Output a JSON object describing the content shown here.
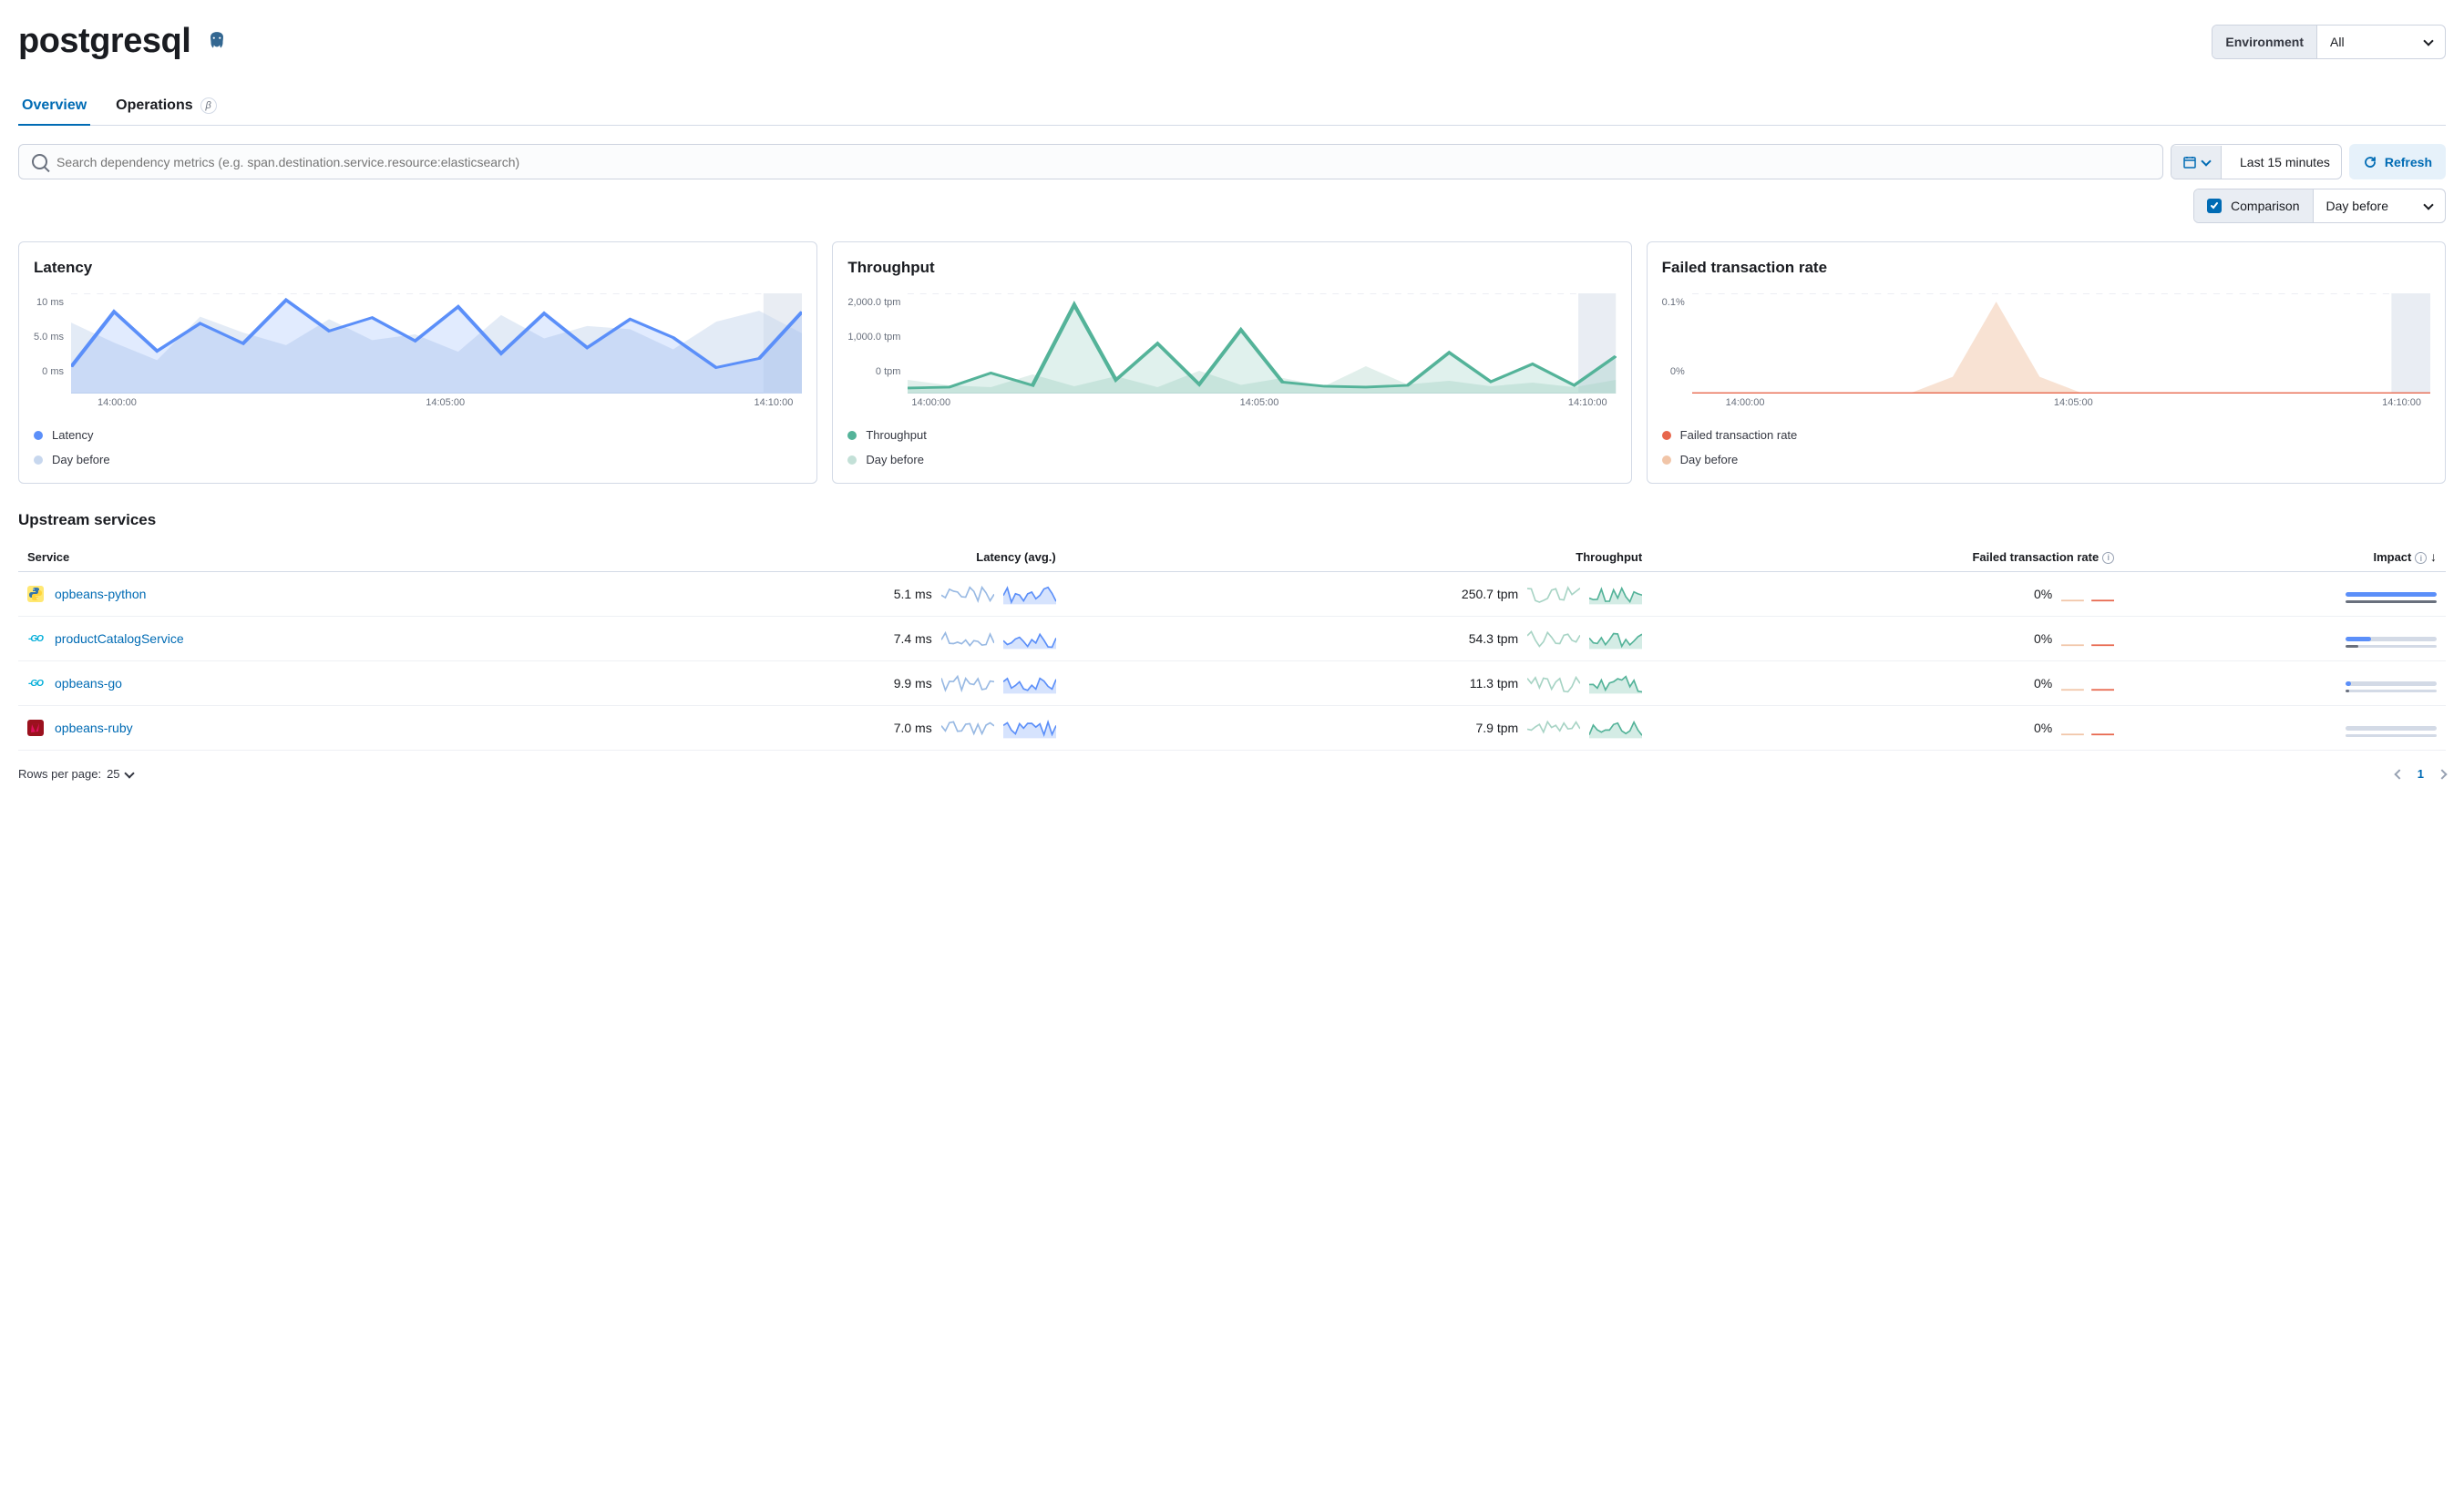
{
  "header": {
    "title": "postgresql",
    "environment_label": "Environment",
    "environment_value": "All"
  },
  "tabs": [
    {
      "label": "Overview",
      "active": true
    },
    {
      "label": "Operations",
      "active": false,
      "beta": true,
      "beta_glyph": "β"
    }
  ],
  "search": {
    "placeholder": "Search dependency metrics (e.g. span.destination.service.resource:elasticsearch)"
  },
  "timerange": {
    "value": "Last 15 minutes"
  },
  "refresh_label": "Refresh",
  "comparison": {
    "label": "Comparison",
    "value": "Day before",
    "checked": true
  },
  "chart_x_ticks": [
    "14:00:00",
    "14:05:00",
    "14:10:00"
  ],
  "chart_data": [
    {
      "type": "area",
      "title": "Latency",
      "y_ticks": [
        "10 ms",
        "5.0 ms",
        "0 ms"
      ],
      "ylim": [
        0,
        12
      ],
      "categories": [
        "14:00:00",
        "14:05:00",
        "14:10:00"
      ],
      "series": [
        {
          "name": "Latency",
          "color": "#5b8ff9",
          "values": [
            3.2,
            9.8,
            5.1,
            8.4,
            6.0,
            11.2,
            7.5,
            9.1,
            6.3,
            10.4,
            4.8,
            9.6,
            5.5,
            8.9,
            6.7,
            3.1,
            4.2,
            9.8
          ]
        },
        {
          "name": "Day before",
          "color": "#c7d7ee",
          "values": [
            8.5,
            6.1,
            4.0,
            9.2,
            7.3,
            5.8,
            8.9,
            6.4,
            7.1,
            5.0,
            9.4,
            6.6,
            8.1,
            7.7,
            5.3,
            8.6,
            9.9,
            7.2
          ]
        }
      ],
      "legend": [
        {
          "label": "Latency",
          "color": "#5b8ff9"
        },
        {
          "label": "Day before",
          "color": "#c7d7ee"
        }
      ]
    },
    {
      "type": "area",
      "title": "Throughput",
      "y_ticks": [
        "2,000.0 tpm",
        "1,000.0 tpm",
        "0 tpm"
      ],
      "ylim": [
        0,
        2200
      ],
      "categories": [
        "14:00:00",
        "14:05:00",
        "14:10:00"
      ],
      "series": [
        {
          "name": "Throughput",
          "color": "#54b399",
          "values": [
            120,
            140,
            450,
            180,
            1950,
            300,
            1100,
            200,
            1400,
            250,
            160,
            140,
            180,
            900,
            260,
            650,
            180,
            820
          ]
        },
        {
          "name": "Day before",
          "color": "#c3e0d7",
          "values": [
            300,
            180,
            140,
            420,
            160,
            380,
            140,
            500,
            190,
            340,
            160,
            600,
            200,
            280,
            160,
            240,
            140,
            300
          ]
        }
      ],
      "legend": [
        {
          "label": "Throughput",
          "color": "#54b399"
        },
        {
          "label": "Day before",
          "color": "#c3e0d7"
        }
      ]
    },
    {
      "type": "area",
      "title": "Failed transaction rate",
      "y_ticks": [
        "0.1%",
        "0%"
      ],
      "ylim": [
        0,
        0.12
      ],
      "categories": [
        "14:00:00",
        "14:05:00",
        "14:10:00"
      ],
      "series": [
        {
          "name": "Failed transaction rate",
          "color": "#e7664c",
          "values": [
            0,
            0,
            0,
            0,
            0,
            0,
            0,
            0,
            0,
            0,
            0,
            0,
            0,
            0,
            0,
            0,
            0,
            0
          ]
        },
        {
          "name": "Day before",
          "color": "#f1c5a8",
          "values": [
            0,
            0,
            0,
            0,
            0,
            0,
            0.02,
            0.11,
            0.02,
            0,
            0,
            0,
            0,
            0,
            0,
            0,
            0,
            0
          ]
        }
      ],
      "legend": [
        {
          "label": "Failed transaction rate",
          "color": "#e7664c"
        },
        {
          "label": "Day before",
          "color": "#f1c5a8"
        }
      ]
    }
  ],
  "upstream": {
    "title": "Upstream services",
    "columns": {
      "service": "Service",
      "latency": "Latency (avg.)",
      "throughput": "Throughput",
      "failed": "Failed transaction rate",
      "impact": "Impact"
    },
    "rows": [
      {
        "name": "opbeans-python",
        "lang": "python",
        "lang_color": "#3776ab",
        "lang_bg": "#ffe873",
        "latency": "5.1 ms",
        "throughput": "250.7 tpm",
        "failed": "0%",
        "impact_primary": 100,
        "impact_secondary": 100
      },
      {
        "name": "productCatalogService",
        "lang": "go",
        "lang_color": "#00add8",
        "lang_bg": "#e0f7fa",
        "latency": "7.4 ms",
        "throughput": "54.3 tpm",
        "failed": "0%",
        "impact_primary": 28,
        "impact_secondary": 14
      },
      {
        "name": "opbeans-go",
        "lang": "go",
        "lang_color": "#00add8",
        "lang_bg": "#e0f7fa",
        "latency": "9.9 ms",
        "throughput": "11.3 tpm",
        "failed": "0%",
        "impact_primary": 6,
        "impact_secondary": 4
      },
      {
        "name": "opbeans-ruby",
        "lang": "ruby",
        "lang_color": "#fff",
        "lang_bg": "#9b111e",
        "latency": "7.0 ms",
        "throughput": "7.9 tpm",
        "failed": "0%",
        "impact_primary": 0,
        "impact_secondary": 0
      }
    ]
  },
  "rows_per_page": {
    "label": "Rows per page:",
    "value": "25"
  },
  "pager": {
    "current": "1"
  }
}
